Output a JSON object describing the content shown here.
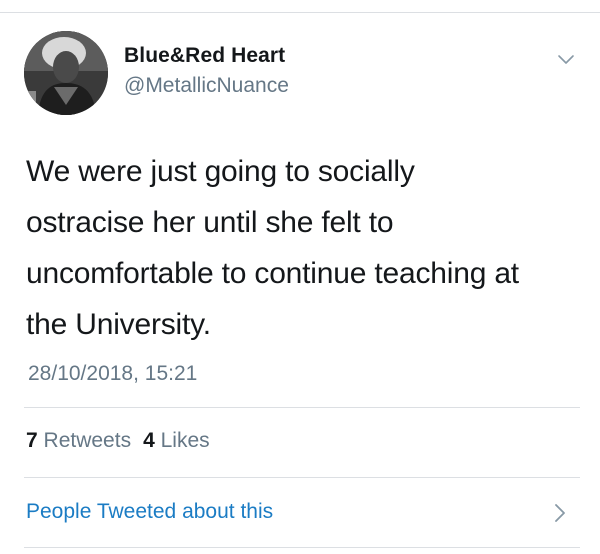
{
  "user": {
    "display_name": "Blue&Red Heart",
    "handle": "@MetallicNuance"
  },
  "tweet": {
    "lines": [
      "We were just going to socially",
      "ostracise her until she felt to",
      "uncomfortable to continue teaching at",
      "the University."
    ],
    "timestamp": "28/10/2018, 15:21"
  },
  "stats": {
    "retweets_count": "7",
    "retweets_label": "Retweets",
    "likes_count": "4",
    "likes_label": "Likes"
  },
  "people": {
    "label": "People Tweeted about this"
  },
  "icons": {
    "caret": "chevron-down-icon",
    "people_chevron": "chevron-right-icon"
  },
  "colors": {
    "text_primary": "#14171a",
    "text_secondary": "#657786",
    "link": "#1b7cc4",
    "divider": "#dcdfe3"
  }
}
